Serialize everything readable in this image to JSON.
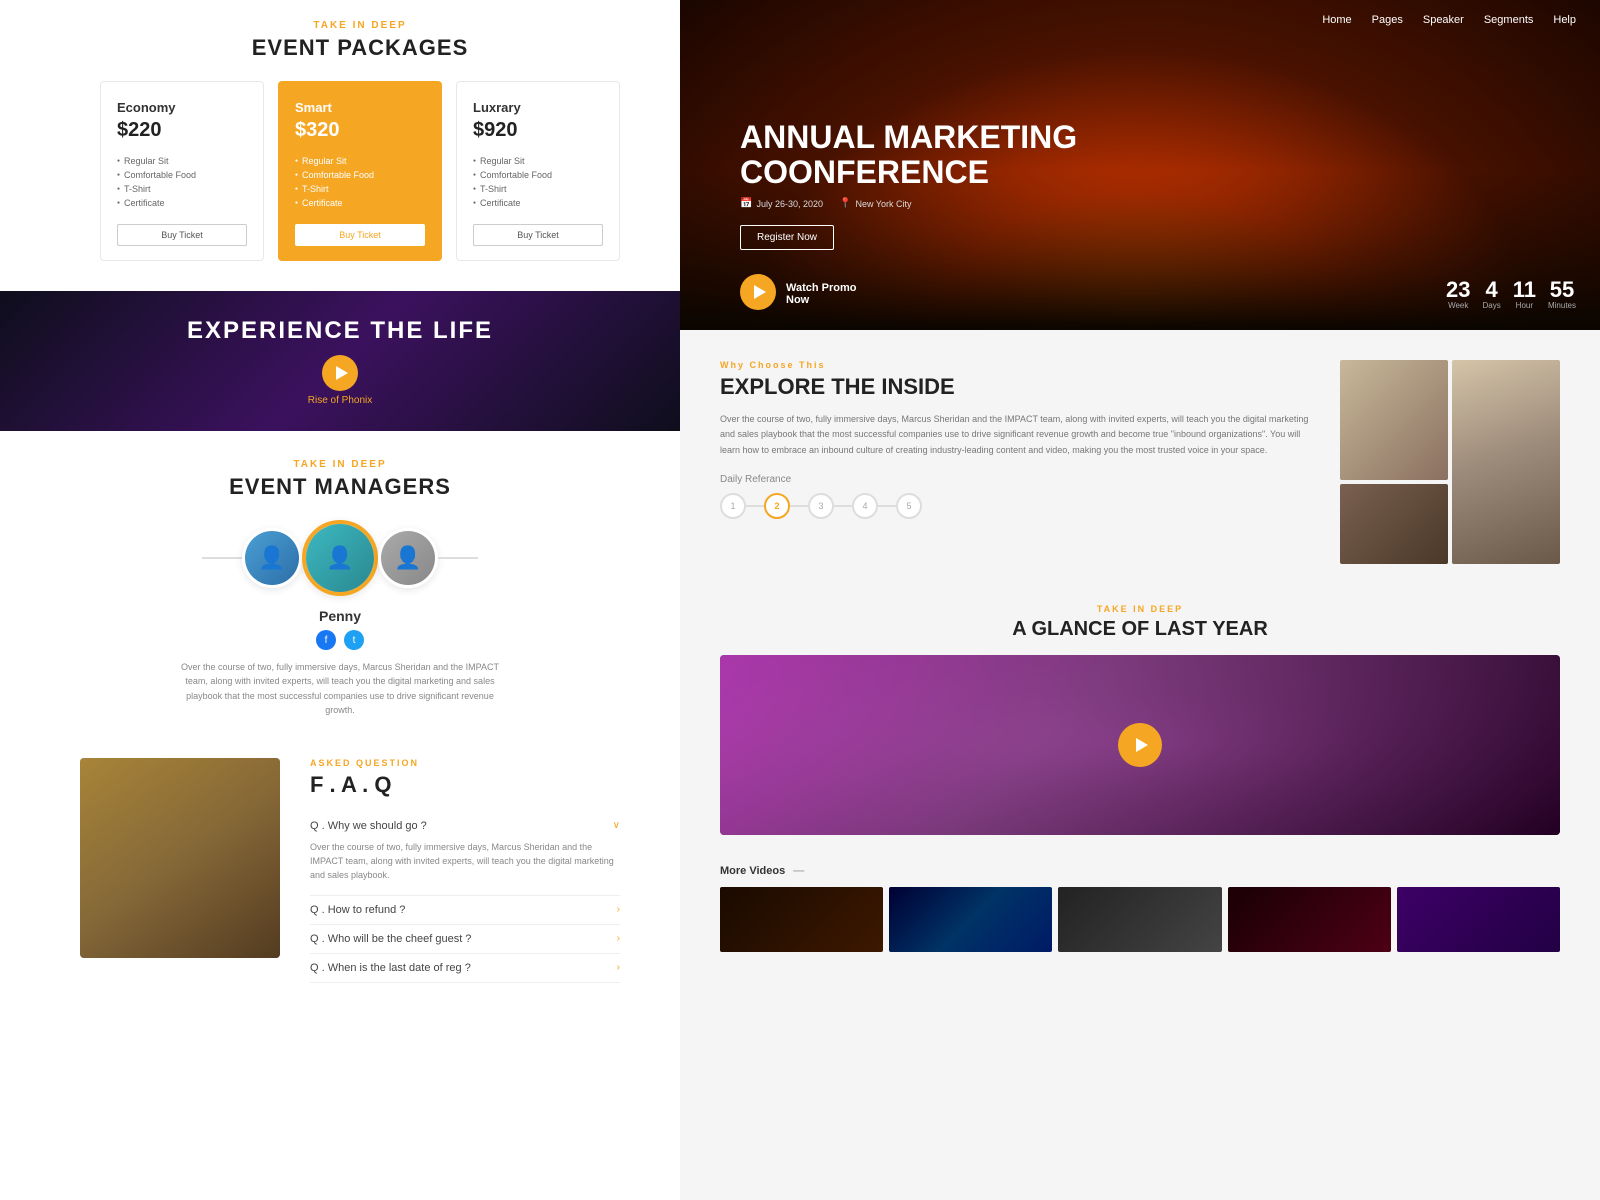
{
  "decorative": {
    "circles": [
      "top-left",
      "top-left2",
      "mid-left",
      "bottom-left",
      "pink-bottom"
    ]
  },
  "left": {
    "packages": {
      "tag": "TAKE IN DEEP",
      "title": "EVENT PACKAGES",
      "items": [
        {
          "name": "Economy",
          "price": "$220",
          "featured": false,
          "features": [
            "Regular Sit",
            "Comfortable Food",
            "T-Shirt",
            "Certificate"
          ],
          "btn_label": "Buy Ticket"
        },
        {
          "name": "Smart",
          "price": "$320",
          "featured": true,
          "features": [
            "Regular Sit",
            "Comfortable Food",
            "T-Shirt",
            "Certificate"
          ],
          "btn_label": "Buy Ticket"
        },
        {
          "name": "Luxrary",
          "price": "$920",
          "featured": false,
          "features": [
            "Regular Sit",
            "Comfortable Food",
            "T-Shirt",
            "Certificate"
          ],
          "btn_label": "Buy Ticket"
        }
      ]
    },
    "experience": {
      "title": "EXPERIENCE THE LIFE",
      "play_label": "Rise of Phonix"
    },
    "managers": {
      "tag": "TAKE IN DEEP",
      "title": "EVENT MANAGERS",
      "featured_name": "Penny",
      "description": "Over the course of two, fully immersive days, Marcus Sheridan and the IMPACT team, along with invited experts, will teach you the digital marketing and sales playbook that the most successful companies use to drive significant revenue growth."
    },
    "faq": {
      "tag": "ASKED QUESTION",
      "title": "F . A . Q",
      "items": [
        {
          "question": "Q . Why we should go ?",
          "answer": "Over the course of two, fully immersive days, Marcus Sheridan and the IMPACT team, along with invited experts, will teach you the digital marketing and sales playbook.",
          "open": true,
          "icon": "chevron-down"
        },
        {
          "question": "Q . How to refund ?",
          "answer": "",
          "open": false,
          "icon": "chevron-right"
        },
        {
          "question": "Q . Who will be the cheef guest ?",
          "answer": "",
          "open": false,
          "icon": "chevron-right"
        },
        {
          "question": "Q . When is the last date of reg ?",
          "answer": "",
          "open": false,
          "icon": "chevron-right"
        }
      ]
    }
  },
  "right": {
    "nav": {
      "items": [
        "Home",
        "Pages",
        "Speaker",
        "Segments",
        "Help"
      ]
    },
    "hero": {
      "title": "ANNUAL MARKETING\nCOONFERENCE",
      "date": "July 26-30, 2020",
      "location": "New York City",
      "btn_label": "Register Now",
      "watch_label": "Watch Promo\nNow",
      "countdown": [
        {
          "num": "23",
          "label": "Week"
        },
        {
          "num": "4",
          "label": "Days"
        },
        {
          "num": "11",
          "label": "Hour"
        },
        {
          "num": "55",
          "label": "Minutes"
        }
      ]
    },
    "explore": {
      "tag": "Why Choose This",
      "title": "EXPLORE THE INSIDE",
      "description": "Over the course of two, fully immersive days, Marcus Sheridan and the IMPACT team, along with invited experts, will teach you the digital marketing and sales playbook that the most successful companies use to drive significant revenue growth and become true \"inbound organizations\". You will learn how to embrace an inbound culture of creating industry-leading content and video, making you the most trusted voice in your space.",
      "daily_ref": "Daily Referance",
      "steps": [
        "1",
        "2",
        "3",
        "4",
        "5"
      ],
      "active_step": 2
    },
    "glance": {
      "tag": "TAKE IN DEEP",
      "title": "A GLANCE OF LAST YEAR",
      "more_videos_label": "More Videos"
    }
  }
}
